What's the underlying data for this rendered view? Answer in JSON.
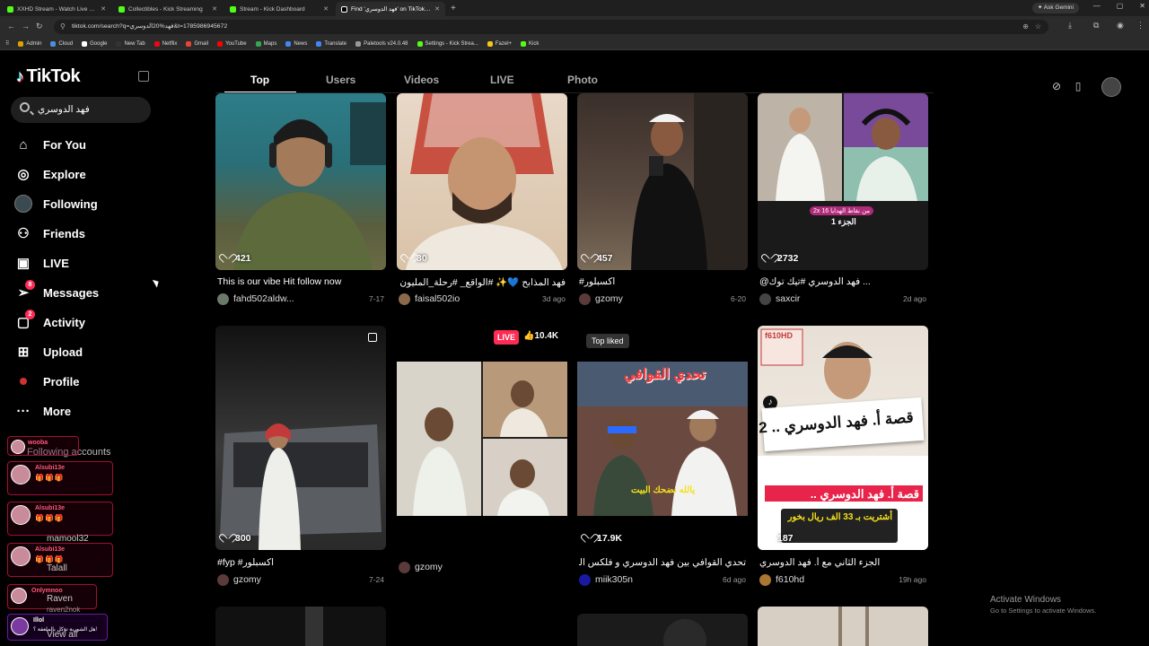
{
  "browser": {
    "tabs": [
      {
        "label": "XXHD Stream - Watch Live on K",
        "color": "#53fc18",
        "active": false
      },
      {
        "label": "Collectibles - Kick Streaming",
        "color": "#53fc18",
        "active": false
      },
      {
        "label": "Stream - Kick Dashboard",
        "color": "#53fc18",
        "active": false
      },
      {
        "label": "Find 'فهد الدوسري' on TikTok | T",
        "color": "#ffffff",
        "active": true
      }
    ],
    "new_tab": "+",
    "ask_gemini": "Ask Gemini",
    "url": "tiktok.com/search?q=فهد%20الدوسري&t=1785986945672",
    "bookmarks": [
      {
        "label": "Admin",
        "color": "#e0a000"
      },
      {
        "label": "Cloud",
        "color": "#4a90e2"
      },
      {
        "label": "Google",
        "color": "#ffffff"
      },
      {
        "label": "New Tab",
        "color": "#333333"
      },
      {
        "label": "Netflix",
        "color": "#e50914"
      },
      {
        "label": "Gmail",
        "color": "#ea4335"
      },
      {
        "label": "YouTube",
        "color": "#ff0000"
      },
      {
        "label": "Maps",
        "color": "#34a853"
      },
      {
        "label": "News",
        "color": "#4285f4"
      },
      {
        "label": "Translate",
        "color": "#4285f4"
      },
      {
        "label": "Paletools v24.0.48",
        "color": "#999999"
      },
      {
        "label": "Settings - Kick Strea...",
        "color": "#53fc18"
      },
      {
        "label": "Fazel+",
        "color": "#f5c518"
      },
      {
        "label": "Kick",
        "color": "#53fc18"
      }
    ]
  },
  "tiktok": {
    "logo": "TikTok",
    "search_value": "فهد الدوسري",
    "nav": [
      {
        "label": "For You",
        "icon": "home-icon",
        "glyph": "⌂",
        "badge": ""
      },
      {
        "label": "Explore",
        "icon": "compass-icon",
        "glyph": "◎",
        "badge": ""
      },
      {
        "label": "Following",
        "icon": "following-avatar-icon",
        "glyph": "●",
        "badge": ""
      },
      {
        "label": "Friends",
        "icon": "friends-icon",
        "glyph": "⚇",
        "badge": ""
      },
      {
        "label": "LIVE",
        "icon": "live-tv-icon",
        "glyph": "▣",
        "badge": ""
      },
      {
        "label": "Messages",
        "icon": "messages-icon",
        "glyph": "➢",
        "badge": "8"
      },
      {
        "label": "Activity",
        "icon": "activity-icon",
        "glyph": "▢",
        "badge": "2"
      },
      {
        "label": "Upload",
        "icon": "upload-plus-icon",
        "glyph": "⊞",
        "badge": ""
      },
      {
        "label": "Profile",
        "icon": "profile-avatar-icon",
        "glyph": "•",
        "badge": ""
      },
      {
        "label": "More",
        "icon": "more-dots-icon",
        "glyph": "···",
        "badge": ""
      }
    ],
    "following_accounts": "Following accounts",
    "overlay_names": [
      "wooba",
      "Alsubi13e",
      "Alsubi13e",
      "Alsubi13e",
      "Onlymnoo",
      "Illol"
    ],
    "overlay_last_text": "هل الشوربة تؤكل بالملعقة ؟!",
    "following_users": [
      "mamool32",
      "Talall",
      "Raven",
      "raven2nok"
    ],
    "view_all": "View all",
    "search_tabs": [
      "Top",
      "Users",
      "Videos",
      "LIVE",
      "Photo"
    ],
    "active_tab": "Top"
  },
  "videos": [
    {
      "likes": "421",
      "caption": "This is our vibe Hit follow now",
      "user": "fahd502aldw...",
      "date": "7-17",
      "avatar": "#6a7a6a"
    },
    {
      "likes": "30",
      "caption": "فهد المذابح 💙✨ #الواقع_ #رحلة_المليون ...",
      "user": "faisal502io",
      "date": "3d ago",
      "avatar": "#8a6a4a"
    },
    {
      "likes": "457",
      "caption": "#اكسبلور",
      "user": "gzomy",
      "date": "6-20",
      "avatar": "#5a3a3a"
    },
    {
      "likes": "2732",
      "caption": "@فهد الدوسري #تيك توك ...",
      "user": "saxcir",
      "date": "2d ago",
      "avatar": "#444444"
    },
    {
      "likes": "300",
      "caption": "#fyp #اكسبلور",
      "user": "gzomy",
      "date": "7-24",
      "avatar": "#5a3a3a"
    },
    {
      "likes": "",
      "caption": "",
      "user": "gzomy",
      "date": "",
      "avatar": "#5a3a3a",
      "live": "LIVE",
      "live_count": "👍10.4K"
    },
    {
      "likes": "17.9K",
      "caption": "تحدي القوافي بين فهد الدوسري و فلكس الدوسري...",
      "user": "miik305n",
      "date": "6d ago",
      "avatar": "#1a1aa0",
      "top_liked": "Top liked"
    },
    {
      "likes": "187",
      "caption": "الجزء الثاني مع أ. فهد الدوسري",
      "user": "f610hd",
      "date": "19h ago",
      "avatar": "#aa7733"
    }
  ],
  "overlays": {
    "v4_part": "الجزء 1",
    "v7_title": "تحدي القوافي",
    "v7_sub": "يالله نضحك البيت",
    "v8_brand": "f610HD",
    "v8_title": "قصة أ. فهد الدوسري .. 2",
    "v8_banner": "قصة أ. فهد الدوسري ..",
    "v8_note": "أشتريت بـ 33 الف ريال بخور"
  },
  "watermark": {
    "title": "Activate Windows",
    "sub": "Go to Settings to activate Windows."
  }
}
